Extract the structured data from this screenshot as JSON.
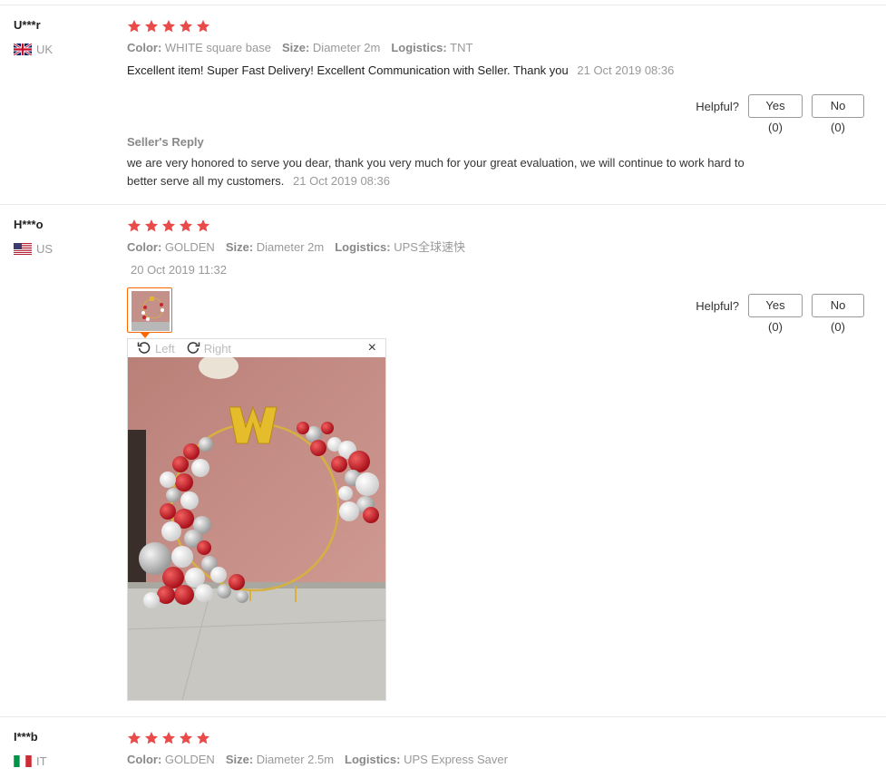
{
  "colors": {
    "star": "#e94b4b",
    "accent": "#ff6600"
  },
  "reviews": [
    {
      "user": "U***r",
      "country": "UK",
      "rating": 5,
      "color_label": "Color:",
      "color_value": "WHITE square base",
      "size_label": "Size:",
      "size_value": "Diameter 2m",
      "logistics_label": "Logistics:",
      "logistics_value": "TNT",
      "feedback": "Excellent item! Super Fast Delivery! Excellent Communication with Seller. Thank you",
      "date": "21 Oct 2019 08:36",
      "helpful_label": "Helpful?",
      "yes_label": "Yes (0)",
      "no_label": "No (0)",
      "reply_title": "Seller's Reply",
      "reply_text": "we are very honored to serve you dear, thank you very much for your great evaluation, we will continue to work hard to better serve all my customers.",
      "reply_date": "21 Oct 2019 08:36"
    },
    {
      "user": "H***o",
      "country": "US",
      "rating": 5,
      "color_label": "Color:",
      "color_value": "GOLDEN",
      "size_label": "Size:",
      "size_value": "Diameter 2m",
      "logistics_label": "Logistics:",
      "logistics_value": "UPS全球速快",
      "date": "20 Oct 2019 11:32",
      "helpful_label": "Helpful?",
      "yes_label": "Yes (0)",
      "no_label": "No (0)",
      "viewer": {
        "left_label": "Left",
        "right_label": "Right",
        "close_glyph": "×"
      }
    },
    {
      "user": "I***b",
      "country": "IT",
      "rating": 5,
      "color_label": "Color:",
      "color_value": "GOLDEN",
      "size_label": "Size:",
      "size_value": "Diameter 2.5m",
      "logistics_label": "Logistics:",
      "logistics_value": "UPS Express Saver"
    }
  ]
}
